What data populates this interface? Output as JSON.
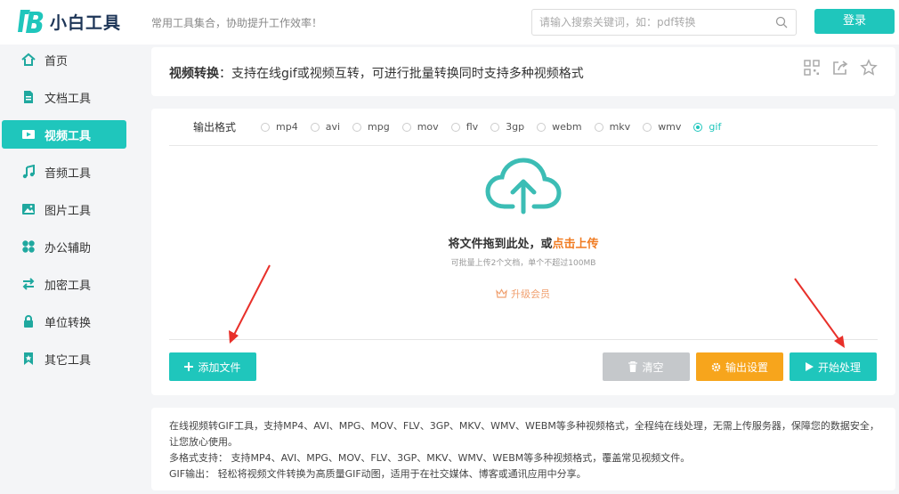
{
  "header": {
    "logo_text": "小白工具",
    "slogan": "常用工具集合，协助提升工作效率！",
    "search_placeholder": "请输入搜索关键词，如：pdf转换",
    "login_label": "登录"
  },
  "sidebar": {
    "items": [
      {
        "label": "首页",
        "icon": "home-icon"
      },
      {
        "label": "文档工具",
        "icon": "document-icon"
      },
      {
        "label": "视频工具",
        "icon": "video-icon",
        "active": true
      },
      {
        "label": "音频工具",
        "icon": "music-icon"
      },
      {
        "label": "图片工具",
        "icon": "image-icon"
      },
      {
        "label": "办公辅助",
        "icon": "office-icon"
      },
      {
        "label": "加密工具",
        "icon": "encrypt-icon"
      },
      {
        "label": "单位转换",
        "icon": "lock-icon"
      },
      {
        "label": "其它工具",
        "icon": "star-bookmark-icon"
      }
    ]
  },
  "title_panel": {
    "name": "视频转换",
    "description": "：支持在线gif或视频互转，可进行批量转换同时支持多种视频格式"
  },
  "formats": {
    "label": "输出格式",
    "options": [
      "mp4",
      "avi",
      "mpg",
      "mov",
      "flv",
      "3gp",
      "webm",
      "mkv",
      "wmv",
      "gif"
    ],
    "selected": "gif"
  },
  "upload": {
    "drop_text": "将文件拖到此处，或",
    "drop_link": "点击上传",
    "hint": "可批量上传2个文档，单个不超过100MB",
    "upgrade_label": "升级会员"
  },
  "buttons": {
    "add": "添加文件",
    "clear": "清空",
    "settings": "输出设置",
    "start": "开始处理"
  },
  "description": {
    "line1": "在线视频转GIF工具，支持MP4、AVI、MPG、MOV、FLV、3GP、MKV、WMV、WEBM等多种视频格式，全程纯在线处理，无需上传服务器，保障您的数据安全，让您放心使用。",
    "line2": "多格式支持： 支持MP4、AVI、MPG、MOV、FLV、3GP、MKV、WMV、WEBM等多种视频格式，覆盖常见视频文件。",
    "line3": "GIF输出： 轻松将视频文件转换为高质量GIF动图，适用于在社交媒体、博客或通讯应用中分享。"
  },
  "colors": {
    "accent": "#1fc6bc",
    "orange": "#f7a51c",
    "link": "#f07b22",
    "annotation_arrow": "#e8302a"
  }
}
